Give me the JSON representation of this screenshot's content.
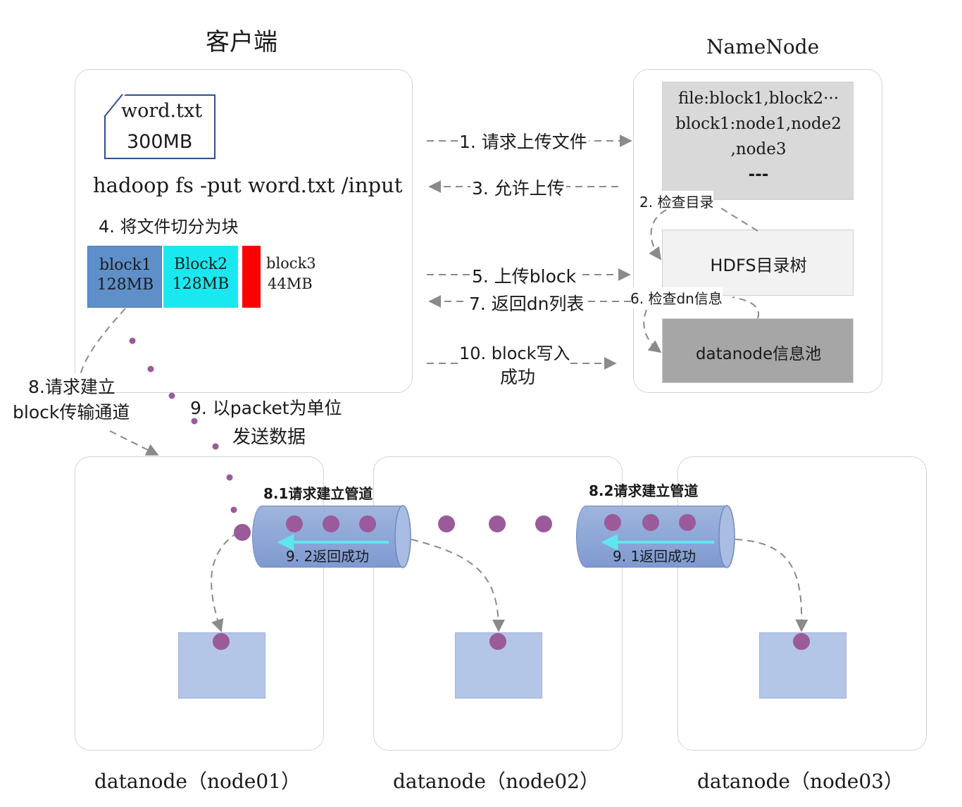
{
  "client": {
    "title": "客户端",
    "file_name": "word.txt",
    "file_size": "300MB",
    "command": "hadoop fs -put word.txt /input",
    "split_step": "4. 将文件切分为块",
    "blocks": [
      {
        "name": "block1",
        "size": "128MB",
        "color": "#5f8fc8"
      },
      {
        "name": "Block2",
        "size": "128MB",
        "color": "#1ae8f0"
      },
      {
        "name": "block3",
        "size": "44MB",
        "color": "#ff0000"
      }
    ]
  },
  "namenode": {
    "title": "NameNode",
    "metadata_lines": [
      "file:block1,block2···",
      "block1:node1,node2",
      ",node3",
      "---"
    ],
    "dir_tree": "HDFS目录树",
    "info_pool": "datanode信息池",
    "check_dir": "2. 检查目录",
    "check_dn": "6. 检查dn信息"
  },
  "steps": {
    "s1": "1. 请求上传文件",
    "s3": "3. 允许上传",
    "s5": "5. 上传block",
    "s7": "7. 返回dn列表",
    "s10_line1": "10. block写入",
    "s10_line2": "成功",
    "s8_line1": "8.请求建立",
    "s8_line2": "block传输通道",
    "s9_line1": "9. 以packet为单位",
    "s9_line2": "发送数据"
  },
  "pipeline": {
    "p81": "8.1请求建立管道",
    "p82": "8.2请求建立管道",
    "r92": "9. 2返回成功",
    "r91": "9. 1返回成功"
  },
  "datanodes": [
    {
      "label": "datanode（node01）"
    },
    {
      "label": "datanode（node02）"
    },
    {
      "label": "datanode（node03）"
    }
  ],
  "colors": {
    "packet": "#9b5a9a",
    "pipe": "#8ea6da",
    "storage": "#b4c6e7",
    "arrow": "#888888",
    "return_arrow": "#5fe6f0"
  }
}
